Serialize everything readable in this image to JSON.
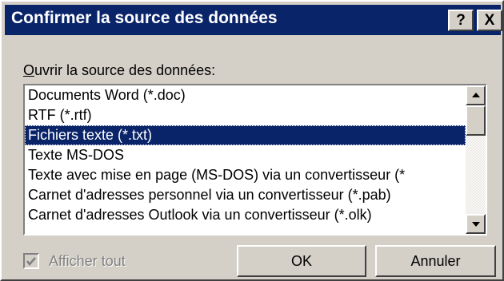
{
  "dialog": {
    "title": "Confirmer la source des données",
    "help_label": "?",
    "close_label": "X"
  },
  "source_label": {
    "mnemonic": "O",
    "rest": "uvrir la source des données:"
  },
  "list": {
    "items": [
      "Documents Word (*.doc)",
      "RTF (*.rtf)",
      "Fichiers texte (*.txt)",
      "Texte MS-DOS",
      "Texte avec mise en page (MS-DOS) via un convertisseur (*",
      "Carnet d'adresses personnel via un convertisseur (*.pab)",
      "Carnet d'adresses Outlook via un convertisseur (*.olk)"
    ],
    "selected_index": 2
  },
  "show_all": {
    "label": "Afficher tout",
    "checked": true,
    "enabled": false
  },
  "buttons": {
    "ok": "OK",
    "cancel": "Annuler"
  },
  "colors": {
    "titlebar": "#0a246a",
    "face": "#d4d0c8",
    "selection": "#0a246a"
  }
}
